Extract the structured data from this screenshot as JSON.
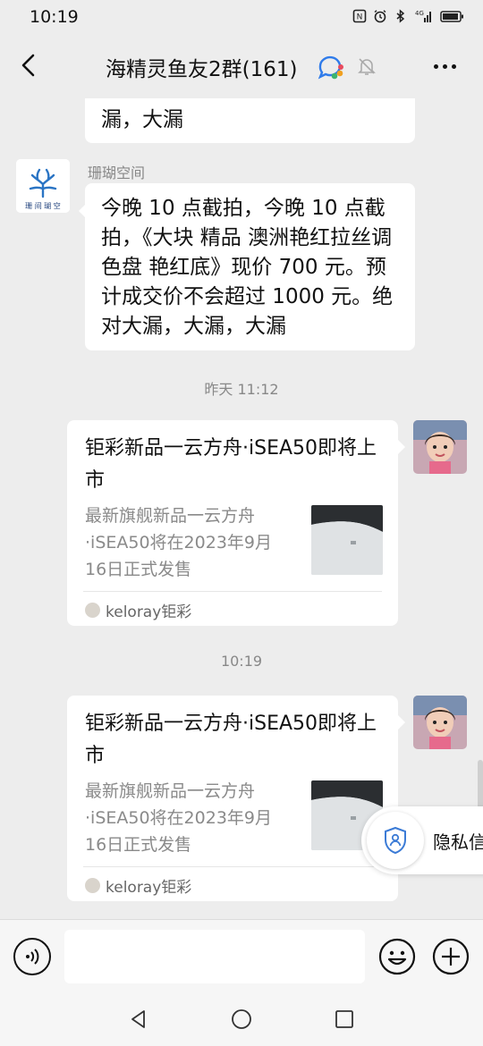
{
  "status_bar": {
    "time": "10:19",
    "network_label": "4G"
  },
  "header": {
    "title": "海精灵鱼友2群(161)"
  },
  "messages": {
    "cut_off_text": "漏，大漏",
    "sender_name": "珊瑚空间",
    "avatar_logo_text": "珊 间 瑚 空",
    "main_text": "今晚 10 点截拍，今晚 10 点截拍，《大块 精品 澳洲艳红拉丝调色盘 艳红底》现价 700 元。预计成交价不会超过 1000 元。绝对大漏，大漏，大漏",
    "timestamp_1": "昨天 11:12",
    "timestamp_2": "10:19",
    "cards": [
      {
        "title": "钜彩新品一云方舟·iSEA50即将上市",
        "description": "最新旗舰新品一云方舟·iSEA50将在2023年9月16日正式发售",
        "source": "keloray钜彩"
      },
      {
        "title": "钜彩新品一云方舟·iSEA50即将上市",
        "description": "最新旗舰新品一云方舟·iSEA50将在2023年9月16日正式发售",
        "source": "keloray钜彩"
      }
    ]
  },
  "privacy_popup": {
    "label": "隐私信"
  },
  "input": {
    "value": "",
    "placeholder": ""
  },
  "icons": {
    "back": "back-arrow-icon",
    "group": "group-chat-icon",
    "mute": "bell-muted-icon",
    "more": "more-dots-icon",
    "voice": "voice-icon",
    "emoji": "emoji-icon",
    "plus": "plus-icon",
    "privacy": "shield-user-icon"
  },
  "colors": {
    "background": "#ededed",
    "bubble": "#ffffff",
    "meta_text": "#888888"
  }
}
